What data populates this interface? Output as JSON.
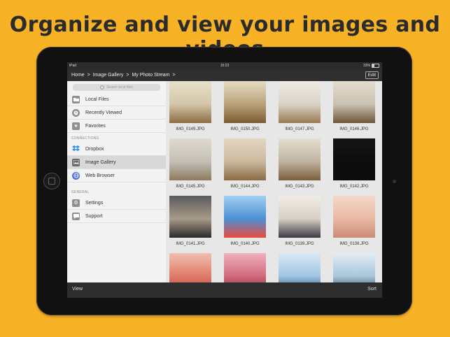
{
  "headline": "Organize and view your images and videos",
  "status_bar": {
    "carrier": "iPad",
    "time": "15:23",
    "battery": "33%"
  },
  "nav": {
    "breadcrumb": [
      "Home",
      "Image Gallery",
      "My Photo Stream"
    ],
    "separator": ">",
    "edit_label": "Edit"
  },
  "sidebar": {
    "search_placeholder": "Search local files",
    "items": [
      {
        "label": "Local Files",
        "icon": "folder-icon",
        "color": "#8e8e93"
      },
      {
        "label": "Recently Viewed",
        "icon": "clock-icon",
        "color": "#8e8e93"
      },
      {
        "label": "Favorites",
        "icon": "star-icon",
        "color": "#8e8e93"
      }
    ],
    "connections_header": "CONNECTIONS",
    "connections": [
      {
        "label": "Dropbox",
        "icon": "dropbox-icon",
        "color": "#2f8de4"
      },
      {
        "label": "Image Gallery",
        "icon": "gallery-icon",
        "color": "#6b6b6b",
        "active": true
      },
      {
        "label": "Web Browser",
        "icon": "globe-icon",
        "color": "#4a6fd1"
      }
    ],
    "general_header": "GENERAL",
    "general": [
      {
        "label": "Settings",
        "icon": "gear-icon",
        "color": "#8e8e93"
      },
      {
        "label": "Support",
        "icon": "chat-icon",
        "color": "#8e8e93"
      }
    ]
  },
  "gallery": {
    "images": [
      {
        "name": "IMG_0149.JPG",
        "colors": [
          "#d4c6a8",
          "#8a6d44",
          "#e8e0cc"
        ]
      },
      {
        "name": "IMG_0150.JPG",
        "colors": [
          "#b9a27a",
          "#7b5a32",
          "#e6dcc3"
        ]
      },
      {
        "name": "IMG_0147.JPG",
        "colors": [
          "#d8d2c6",
          "#9a7a52",
          "#f0ece4"
        ]
      },
      {
        "name": "IMG_0146.JPG",
        "colors": [
          "#c9c1b2",
          "#6e5638",
          "#e4dccd"
        ]
      },
      {
        "name": "IMG_0145.JPG",
        "colors": [
          "#c4c0b6",
          "#8c7a5e",
          "#dedad0"
        ]
      },
      {
        "name": "IMG_0144.JPG",
        "colors": [
          "#cbb99e",
          "#8a6a45",
          "#e2d6c2"
        ]
      },
      {
        "name": "IMG_0143.JPG",
        "colors": [
          "#bfb3a0",
          "#7a5e3c",
          "#e5dfd2"
        ]
      },
      {
        "name": "IMG_0142.JPG",
        "colors": [
          "#0c0c0c",
          "#0c0c0c",
          "#151515"
        ]
      },
      {
        "name": "IMG_0141.JPG",
        "colors": [
          "#a89b88",
          "#2a2a2a",
          "#5a5a5a"
        ]
      },
      {
        "name": "IMG_0140.JPG",
        "colors": [
          "#4d8fd6",
          "#e84b3c",
          "#9fd0f0"
        ]
      },
      {
        "name": "IMG_0139.JPG",
        "colors": [
          "#d8cfc3",
          "#3a3a44",
          "#f1ede6"
        ]
      },
      {
        "name": "IMG_0138.JPG",
        "colors": [
          "#e9b9a4",
          "#c98c78",
          "#f4d8c8"
        ]
      },
      {
        "name": "",
        "colors": [
          "#e07a6a",
          "#b24a3c",
          "#f0c0b0"
        ]
      },
      {
        "name": "",
        "colors": [
          "#d06a7a",
          "#7a2a3a",
          "#f0b0c0"
        ]
      },
      {
        "name": "",
        "colors": [
          "#9ec6e4",
          "#1f3f5f",
          "#dbe9f4"
        ]
      },
      {
        "name": "",
        "colors": [
          "#a7c6dc",
          "#2a3a4a",
          "#e2ecf4"
        ]
      }
    ]
  },
  "toolbar": {
    "view_label": "View",
    "sort_label": "Sort"
  }
}
